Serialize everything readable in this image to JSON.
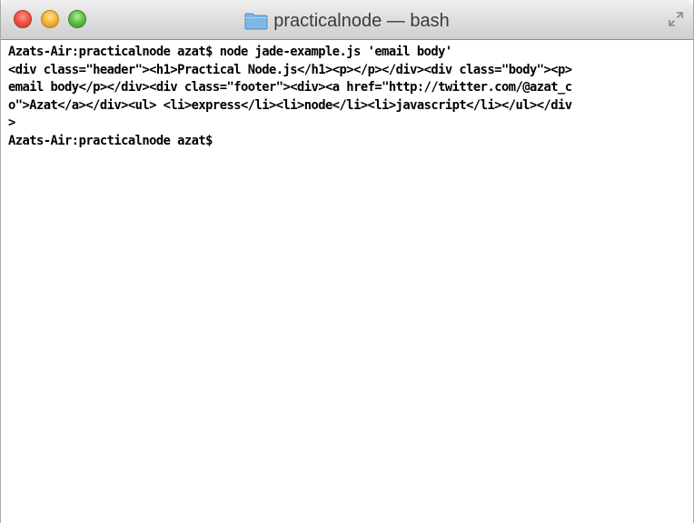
{
  "window": {
    "title": "practicalnode — bash",
    "folder_icon": "folder-icon",
    "fullscreen_icon": "fullscreen-arrows-icon"
  },
  "terminal": {
    "lines": [
      "Azats-Air:practicalnode azat$ node jade-example.js 'email body'",
      "<div class=\"header\"><h1>Practical Node.js</h1><p></p></div><div class=\"body\"><p>",
      "email body</p></div><div class=\"footer\"><div><a href=\"http://twitter.com/@azat_c",
      "o\">Azat</a></div><ul> <li>express</li><li>node</li><li>javascript</li></ul></div",
      ">",
      "Azats-Air:practicalnode azat$"
    ]
  },
  "colors": {
    "close": "#f2564a",
    "minimize": "#f6b73c",
    "zoom": "#63c34a",
    "folder": "#7fb7e6",
    "text": "#000000"
  }
}
